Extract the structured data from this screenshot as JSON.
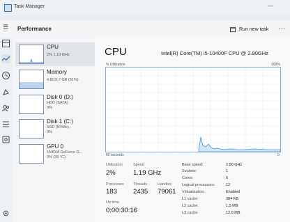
{
  "app": {
    "title": "Task Manager"
  },
  "toolbar": {
    "page_title": "Performance",
    "run_new_task": "Run new task"
  },
  "sidebar": {
    "items": [
      {
        "name": "CPU",
        "lines": [
          "2% 1.19 GHz"
        ]
      },
      {
        "name": "Memory",
        "lines": [
          "4.8/15.7 GB (31%)"
        ]
      },
      {
        "name": "Disk 0 (D:)",
        "lines": [
          "HDD (SATA)",
          "0%"
        ]
      },
      {
        "name": "Disk 1 (C:)",
        "lines": [
          "SSD (NVMe)",
          "0%"
        ]
      },
      {
        "name": "GPU 0",
        "lines": [
          "NVIDIA GeForce G...",
          "0% (35 °C)"
        ]
      }
    ]
  },
  "main": {
    "title": "CPU",
    "model": "Intel(R) Core(TM) i5-10400F CPU @ 2.90GHz",
    "graph": {
      "ylabel": "% Utilization",
      "ymax": "100%",
      "xlabel_left": "60 seconds",
      "xlabel_right": "0",
      "series_color": "#4a90d0"
    },
    "stats": {
      "utilization": {
        "label": "Utilization",
        "value": "2%"
      },
      "speed": {
        "label": "Speed",
        "value": "1.19 GHz"
      },
      "processes": {
        "label": "Processes",
        "value": "183"
      },
      "threads": {
        "label": "Threads",
        "value": "2435"
      },
      "handles": {
        "label": "Handles",
        "value": "79061"
      },
      "uptime": {
        "label": "Up time",
        "value": "0:00:30:16"
      }
    },
    "specs": [
      {
        "label": "Base speed:",
        "value": "2.90 GHz"
      },
      {
        "label": "Sockets:",
        "value": "1"
      },
      {
        "label": "Cores:",
        "value": "6"
      },
      {
        "label": "Logical processors:",
        "value": "12"
      },
      {
        "label": "Virtualization:",
        "value": "Enabled"
      },
      {
        "label": "L1 cache:",
        "value": "384 KB"
      },
      {
        "label": "L2 cache:",
        "value": "1.5 MB"
      },
      {
        "label": "L3 cache:",
        "value": "12.0 MB"
      }
    ]
  }
}
